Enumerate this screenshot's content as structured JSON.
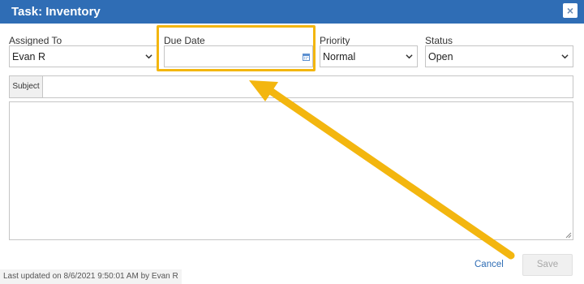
{
  "dialog": {
    "title": "Task: Inventory",
    "close_glyph": "×"
  },
  "fields": {
    "assigned_to": {
      "label": "Assigned To",
      "value": "Evan R"
    },
    "due_date": {
      "label": "Due Date",
      "value": ""
    },
    "priority": {
      "label": "Priority",
      "value": "Normal"
    },
    "status": {
      "label": "Status",
      "value": "Open"
    },
    "subject": {
      "label": "Subject",
      "value": ""
    },
    "body": {
      "value": ""
    }
  },
  "actions": {
    "cancel_label": "Cancel",
    "save_label": "Save"
  },
  "footer": {
    "last_updated": "Last updated on 8/6/2021 9:50:01 AM by Evan R"
  },
  "colors": {
    "title_bar": "#2f6db5",
    "highlight": "#f3b60f",
    "link": "#2f6db5"
  },
  "icons": [
    "close-icon",
    "chevron-down-icon",
    "calendar-icon",
    "resize-grip-icon",
    "annotation-arrow"
  ]
}
